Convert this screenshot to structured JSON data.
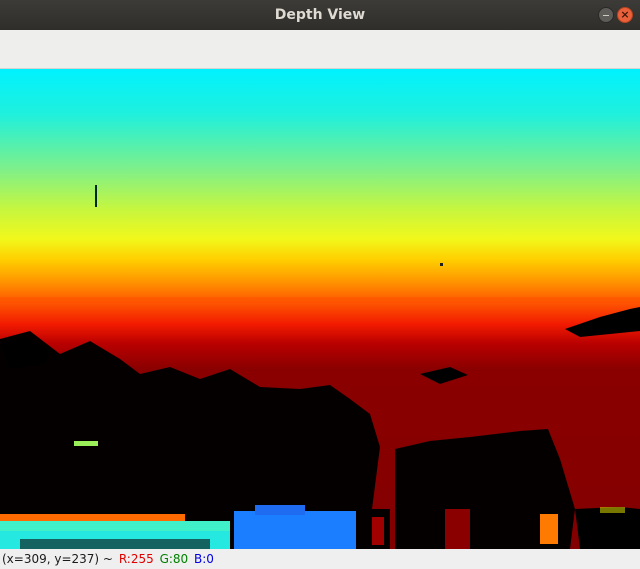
{
  "window": {
    "title": "Depth View"
  },
  "titlebar": {
    "close_glyph": "×",
    "minimize_icon": "minimize-icon",
    "close_icon": "close-icon"
  },
  "image": {
    "description_colormap": "jet"
  },
  "status": {
    "coords": "(x=309, y=237) ~",
    "r_label": "R:255",
    "g_label": "G:80",
    "b_label": "B:0",
    "colors": {
      "r": "#e00000",
      "g": "#008000",
      "b": "#0000e0"
    }
  }
}
